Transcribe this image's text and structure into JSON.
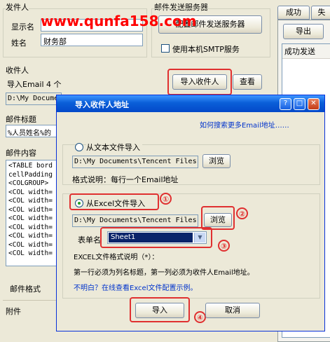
{
  "main": {
    "sender_section": "发件人",
    "display_name_label": "显示名",
    "name_label": "姓名",
    "name_value": "财务部",
    "server_section": "邮件发送服务器",
    "config_server_button": "配置邮件发送服务器",
    "use_smtp_label": "使用本机SMTP服务",
    "recipients_section": "收件人",
    "import_count_text": "导入Email 4 个",
    "import_recipients_button": "导入收件人",
    "view_button": "查看",
    "recipient_path": "D:\\My Documents\\",
    "subject_section": "邮件标题",
    "subject_value": "%人员姓名%的",
    "content_section": "邮件内容",
    "content_lines": [
      "<TABLE bord",
      "cellPadding",
      "<COLGROUP>",
      "<COL width=",
      "<COL width=",
      "<COL width=",
      "<COL width=",
      "<COL width=",
      "<COL width=",
      "<COL width=",
      "<COL width="
    ],
    "format_label": "邮件格式",
    "attachment_label": "附件",
    "tab_success": "成功",
    "tab_fail": "失",
    "export_button": "导出",
    "success_sent_header": "成功发送"
  },
  "watermark": "www.qunfa158.com",
  "dialog": {
    "title": "导入收件人地址",
    "help_link": "如何搜索更多Email地址……",
    "text_import_label": "从文本文件导入",
    "text_path": "D:\\My Documents\\Tencent Files",
    "browse1": "浏览",
    "text_format_note": "格式说明：每行一个Email地址",
    "excel_import_label": "从Excel文件导入",
    "excel_path": "D:\\My Documents\\Tencent Files",
    "browse2": "浏览",
    "sheet_label": "表单名",
    "sheet_value": "Sheet1",
    "excel_format_title": "EXCEL文件格式说明（*）：",
    "excel_format_desc": "第一行必须为列名标题，第一列必须为收件人Email地址。",
    "example_link": "不明白？在线查看Excel文件配置示例。",
    "import_button": "导入",
    "cancel_button": "取消",
    "markers": [
      "①",
      "②",
      "③",
      "④"
    ]
  },
  "colors": {
    "title_bar": "#0a5fd8",
    "link": "#0033cc",
    "annotation": "#e03030",
    "watermark": "#ff0000"
  }
}
